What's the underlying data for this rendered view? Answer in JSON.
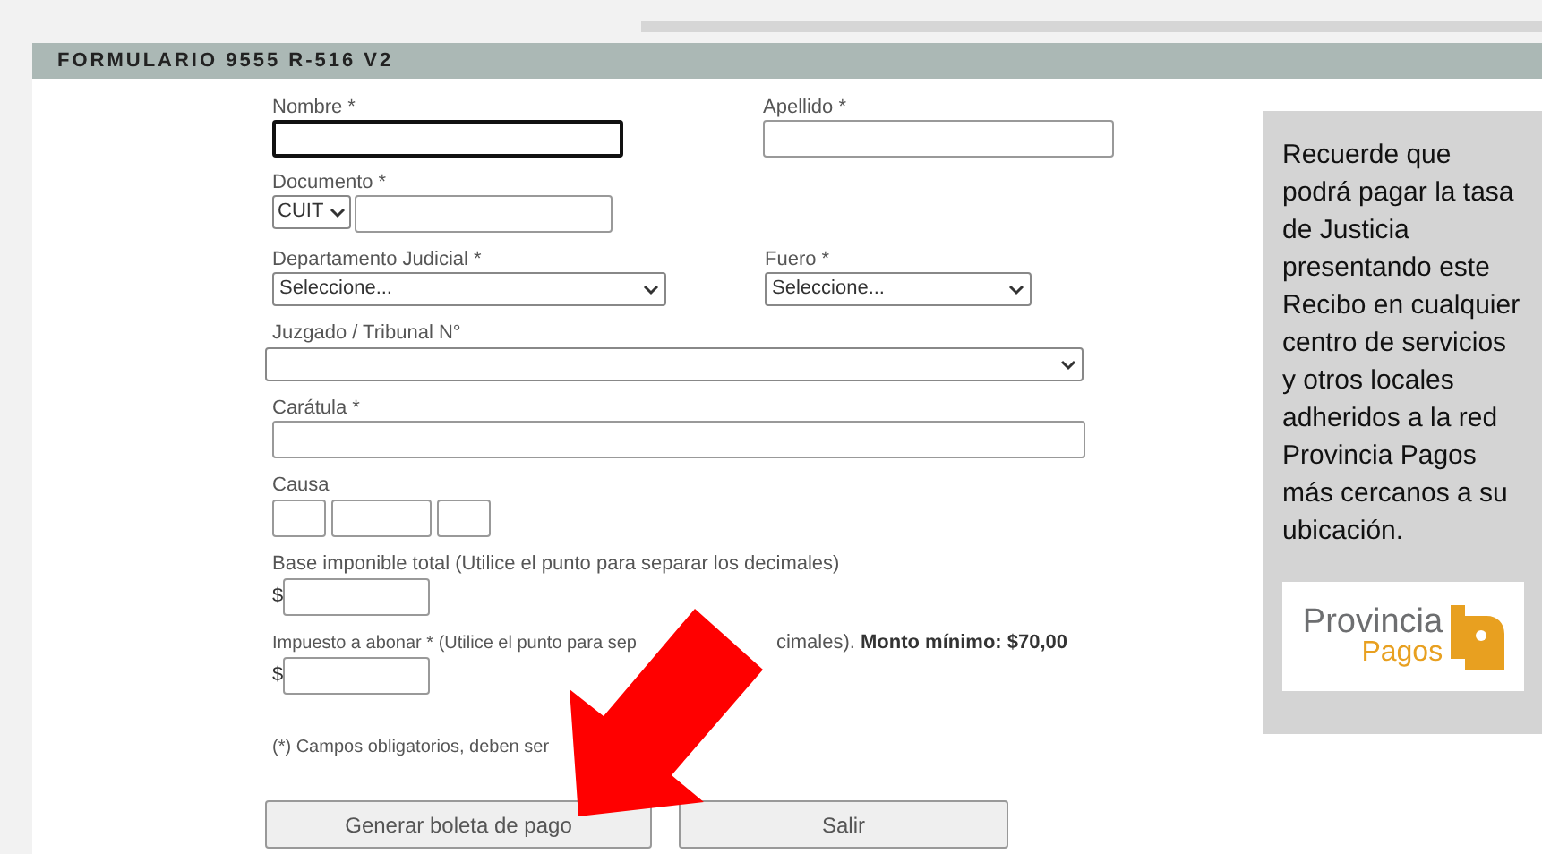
{
  "header": {
    "title": "FORMULARIO 9555 R-516 V2"
  },
  "form": {
    "nombre": {
      "label": "Nombre *",
      "focused": true
    },
    "apellido": {
      "label": "Apellido *",
      "focused": false
    },
    "documento": {
      "label": "Documento *",
      "type_value": "CUIT"
    },
    "departamento": {
      "label": "Departamento Judicial *",
      "value": "Seleccione..."
    },
    "fuero": {
      "label": "Fuero *",
      "value": "Seleccione..."
    },
    "juzgado": {
      "label": "Juzgado / Tribunal N°"
    },
    "caratula": {
      "label": "Carátula *"
    },
    "causa": {
      "label": "Causa"
    },
    "base": {
      "label": "Base imponible total (Utilice el punto para separar los decimales)",
      "currency": "$"
    },
    "impuesto": {
      "label_parts": [
        "Impuesto a abonar * (Utilice el punto para sep",
        "cimales). **Monto mínimo: $70,00**"
      ],
      "currency": "$"
    },
    "note": "(*) Campos obligatorios, deben ser"
  },
  "buttons": [
    {
      "label": "Generar boleta de pago"
    },
    {
      "label": "Salir"
    }
  ],
  "aside": {
    "text": "Recuerde que podrá pagar la tasa de Justicia presentando este Recibo en cualquier centro de servicios y otros locales adheridos a la red Provincia Pagos más cercanos a su ubicación.",
    "logo": {
      "line1": "Provincia",
      "line2": "Pagos"
    }
  }
}
